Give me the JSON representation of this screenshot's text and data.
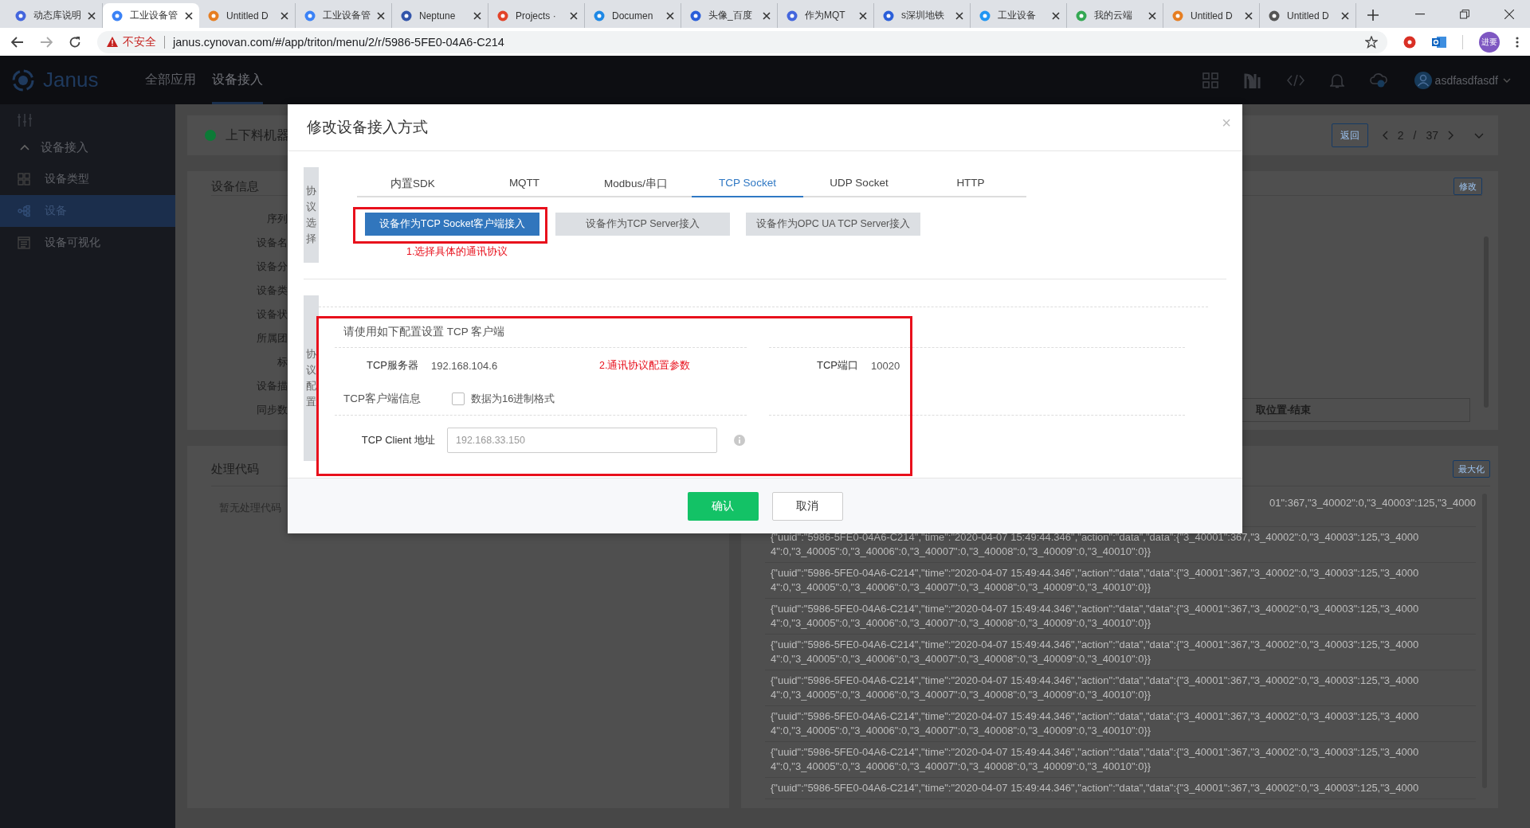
{
  "browser": {
    "tabs": [
      {
        "title": "动态库说明",
        "selected": false
      },
      {
        "title": "工业设备管",
        "selected": true
      },
      {
        "title": "Untitled D",
        "selected": false
      },
      {
        "title": "工业设备管",
        "selected": false
      },
      {
        "title": "Neptune",
        "selected": false
      },
      {
        "title": "Projects ·",
        "selected": false
      },
      {
        "title": "Documen",
        "selected": false
      },
      {
        "title": "头像_百度",
        "selected": false
      },
      {
        "title": "作为MQT",
        "selected": false
      },
      {
        "title": "s深圳地铁",
        "selected": false
      },
      {
        "title": "工业设备",
        "selected": false
      },
      {
        "title": "我的云端",
        "selected": false
      },
      {
        "title": "Untitled D",
        "selected": false
      },
      {
        "title": "Untitled D",
        "selected": false
      }
    ],
    "warning": "不安全",
    "url": "janus.cynovan.com/#/app/triton/menu/2/r/5986-5FE0-04A6-C214",
    "profile": "进要"
  },
  "app": {
    "logo": "Janus",
    "nav": [
      {
        "label": "全部应用",
        "selected": false
      },
      {
        "label": "设备接入",
        "selected": true
      }
    ],
    "user": "asdfasdfasdf"
  },
  "sidebar": {
    "group": {
      "label": "设备接入",
      "expanded": true,
      "items": [
        {
          "label": "设备类型",
          "selected": false
        },
        {
          "label": "设备",
          "selected": true
        },
        {
          "label": "设备可视化",
          "selected": false
        }
      ]
    }
  },
  "page": {
    "device_name": "上下料机器",
    "back": "返回",
    "pager": {
      "current": "2",
      "separator": "/",
      "total": "37"
    },
    "info": {
      "title": "设备信息",
      "edit": "修改",
      "labels": [
        "序列",
        "设备名",
        "设备分",
        "设备类",
        "设备状",
        "所属团",
        "标",
        "设备描",
        "同步数"
      ],
      "field": "取位置-结束"
    },
    "code": {
      "title": "处理代码",
      "empty": "暂无处理代码"
    },
    "log": {
      "maximize": "最大化",
      "rows": [
        {
          "lines": [
            "01\":367,\"3_40002\":0,\"3_40003\":125,\"3_4000"
          ]
        },
        {
          "lines": [
            "{\"uuid\":\"5986-5FE0-04A6-C214\",\"time\":\"2020-04-07 15:49:44.346\",\"action\":\"data\",\"data\":{\"3_40001\":367,\"3_40002\":0,\"3_40003\":125,\"3_4000",
            "4\":0,\"3_40005\":0,\"3_40006\":0,\"3_40007\":0,\"3_40008\":0,\"3_40009\":0,\"3_40010\":0}}"
          ]
        },
        {
          "lines": [
            "{\"uuid\":\"5986-5FE0-04A6-C214\",\"time\":\"2020-04-07 15:49:44.346\",\"action\":\"data\",\"data\":{\"3_40001\":367,\"3_40002\":0,\"3_40003\":125,\"3_4000",
            "4\":0,\"3_40005\":0,\"3_40006\":0,\"3_40007\":0,\"3_40008\":0,\"3_40009\":0,\"3_40010\":0}}"
          ]
        },
        {
          "lines": [
            "{\"uuid\":\"5986-5FE0-04A6-C214\",\"time\":\"2020-04-07 15:49:44.346\",\"action\":\"data\",\"data\":{\"3_40001\":367,\"3_40002\":0,\"3_40003\":125,\"3_4000",
            "4\":0,\"3_40005\":0,\"3_40006\":0,\"3_40007\":0,\"3_40008\":0,\"3_40009\":0,\"3_40010\":0}}"
          ]
        },
        {
          "lines": [
            "{\"uuid\":\"5986-5FE0-04A6-C214\",\"time\":\"2020-04-07 15:49:44.346\",\"action\":\"data\",\"data\":{\"3_40001\":367,\"3_40002\":0,\"3_40003\":125,\"3_4000",
            "4\":0,\"3_40005\":0,\"3_40006\":0,\"3_40007\":0,\"3_40008\":0,\"3_40009\":0,\"3_40010\":0}}"
          ]
        },
        {
          "lines": [
            "{\"uuid\":\"5986-5FE0-04A6-C214\",\"time\":\"2020-04-07 15:49:44.346\",\"action\":\"data\",\"data\":{\"3_40001\":367,\"3_40002\":0,\"3_40003\":125,\"3_4000",
            "4\":0,\"3_40005\":0,\"3_40006\":0,\"3_40007\":0,\"3_40008\":0,\"3_40009\":0,\"3_40010\":0}}"
          ]
        },
        {
          "lines": [
            "{\"uuid\":\"5986-5FE0-04A6-C214\",\"time\":\"2020-04-07 15:49:44.346\",\"action\":\"data\",\"data\":{\"3_40001\":367,\"3_40002\":0,\"3_40003\":125,\"3_4000",
            "4\":0,\"3_40005\":0,\"3_40006\":0,\"3_40007\":0,\"3_40008\":0,\"3_40009\":0,\"3_40010\":0}}"
          ]
        },
        {
          "lines": [
            "{\"uuid\":\"5986-5FE0-04A6-C214\",\"time\":\"2020-04-07 15:49:44.346\",\"action\":\"data\",\"data\":{\"3_40001\":367,\"3_40002\":0,\"3_40003\":125,\"3_4000",
            "4\":0,\"3_40005\":0,\"3_40006\":0,\"3_40007\":0,\"3_40008\":0,\"3_40009\":0,\"3_40010\":0}}"
          ]
        },
        {
          "lines": [
            "{\"uuid\":\"5986-5FE0-04A6-C214\",\"time\":\"2020-04-07 15:49:44.346\",\"action\":\"data\",\"data\":{\"3_40001\":367,\"3_40002\":0,\"3_40003\":125,\"3_4000"
          ]
        }
      ]
    }
  },
  "dialog": {
    "title": "修改设备接入方式",
    "close": "×",
    "select": {
      "label": "协议选择",
      "tabs": [
        {
          "label": "内置SDK",
          "selected": false
        },
        {
          "label": "MQTT",
          "selected": false
        },
        {
          "label": "Modbus/串口",
          "selected": false
        },
        {
          "label": "TCP Socket",
          "selected": true
        },
        {
          "label": "UDP Socket",
          "selected": false
        },
        {
          "label": "HTTP",
          "selected": false
        }
      ],
      "options": [
        {
          "label": "设备作为TCP Socket客户端接入",
          "selected": true
        },
        {
          "label": "设备作为TCP Server接入",
          "selected": false
        },
        {
          "label": "设备作为OPC UA TCP Server接入",
          "selected": false
        }
      ],
      "note": "1.选择具体的通讯协议"
    },
    "config": {
      "label": "协议配置",
      "heading": "请使用如下配置设置 TCP 客户端",
      "server_label": "TCP服务器",
      "server": "192.168.104.6",
      "note": "2.通讯协议配置参数",
      "port_label": "TCP端口",
      "port": "10020",
      "client_label": "TCP客户端信息",
      "hex": {
        "label": "数据为16进制格式",
        "checked": false
      },
      "address_label": "TCP Client 地址",
      "address_placeholder": "192.168.33.150"
    },
    "buttons": {
      "confirm": "确认",
      "cancel": "取消"
    }
  }
}
